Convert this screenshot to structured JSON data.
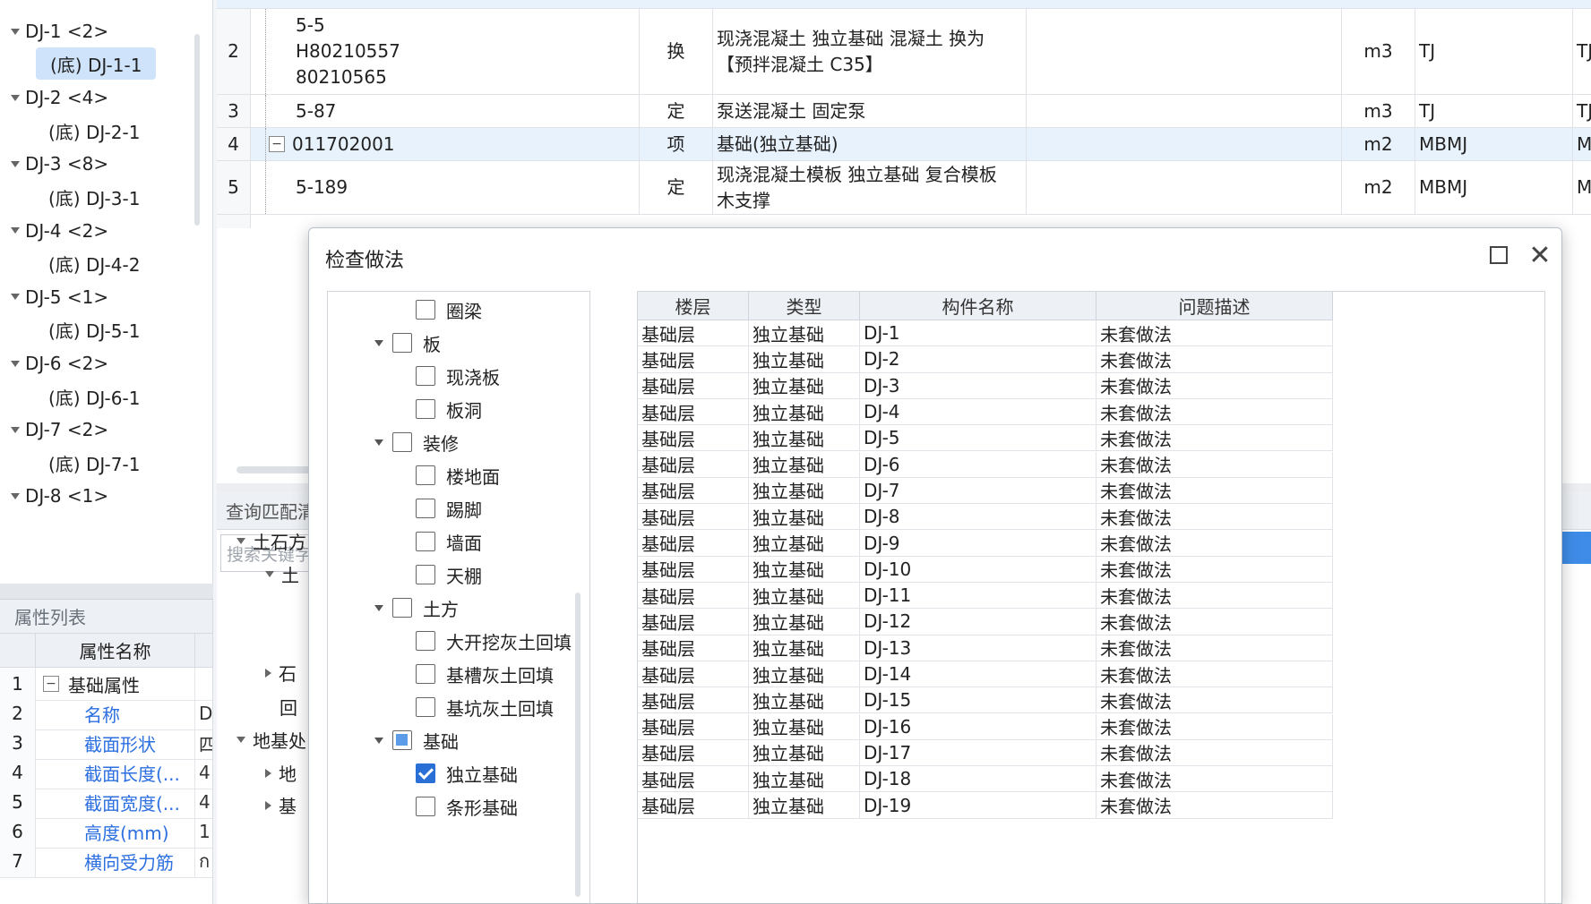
{
  "left_tree": {
    "items": [
      {
        "label": "DJ-1 <2>",
        "level": 0
      },
      {
        "label": "(底) DJ-1-1",
        "level": 1,
        "selected": true
      },
      {
        "label": "DJ-2 <4>",
        "level": 0
      },
      {
        "label": "(底) DJ-2-1",
        "level": 1
      },
      {
        "label": "DJ-3 <8>",
        "level": 0
      },
      {
        "label": "(底) DJ-3-1",
        "level": 1
      },
      {
        "label": "DJ-4 <2>",
        "level": 0
      },
      {
        "label": "(底) DJ-4-2",
        "level": 1
      },
      {
        "label": "DJ-5 <1>",
        "level": 0
      },
      {
        "label": "(底) DJ-5-1",
        "level": 1
      },
      {
        "label": "DJ-6 <2>",
        "level": 0
      },
      {
        "label": "(底) DJ-6-1",
        "level": 1
      },
      {
        "label": "DJ-7 <2>",
        "level": 0
      },
      {
        "label": "(底) DJ-7-1",
        "level": 1
      },
      {
        "label": "DJ-8 <1>",
        "level": 0
      }
    ]
  },
  "prop_panel": {
    "title": "属性列表",
    "header_name": "属性名称",
    "rows": [
      {
        "num": "1",
        "name": "基础属性",
        "group": true,
        "value": ""
      },
      {
        "num": "2",
        "name": "名称",
        "value": "D"
      },
      {
        "num": "3",
        "name": "截面形状",
        "value": "四"
      },
      {
        "num": "4",
        "name": "截面长度(...",
        "value": "4"
      },
      {
        "num": "5",
        "name": "截面宽度(...",
        "value": "4"
      },
      {
        "num": "6",
        "name": "高度(mm)",
        "value": "1"
      },
      {
        "num": "7",
        "name": "横向受力筋",
        "value": "ก"
      }
    ]
  },
  "top_table": {
    "rows": [
      {
        "num": "2",
        "code": "5-5\nH80210557\n80210565",
        "type": "换",
        "name": "现浇混凝土 独立基础 混凝土  换为\n【预拌混凝土 C35】",
        "unit": "m3",
        "expr": "TJ",
        "desc": "TJ<独基体积>"
      },
      {
        "num": "3",
        "code": "5-87",
        "type": "定",
        "name": "泵送混凝土 固定泵",
        "unit": "m3",
        "expr": "TJ",
        "desc": "TJ<独基体积>"
      },
      {
        "num": "4",
        "code": "011702001",
        "type": "项",
        "name": "基础(独立基础)",
        "unit": "m2",
        "expr": "MBMJ",
        "desc": "MBMJ<独基模板面积>",
        "group": true
      },
      {
        "num": "5",
        "code": "5-189",
        "type": "定",
        "name": "现浇混凝土模板 独立基础 复合模板\n木支撑",
        "unit": "m2",
        "expr": "MBMJ",
        "desc": "MBMJ<独基模板面积>"
      }
    ]
  },
  "mid_panel": {
    "title": "查询匹配清",
    "search_placeholder": "搜索关键字",
    "tree": [
      {
        "label": "土石方",
        "arrow": "down"
      },
      {
        "label": "土",
        "arrow": "down"
      },
      {
        "label": "石",
        "arrow": "right"
      },
      {
        "label": "回",
        "arrow": "none"
      },
      {
        "label": "地基处",
        "arrow": "down"
      },
      {
        "label": "地",
        "arrow": "right"
      },
      {
        "label": "基",
        "arrow": "right"
      }
    ]
  },
  "dialog": {
    "title": "检查做法",
    "tree": [
      {
        "label": "圈梁",
        "level": 1,
        "state": "none"
      },
      {
        "label": "板",
        "level": 0,
        "state": "none"
      },
      {
        "label": "现浇板",
        "level": 1,
        "state": "none"
      },
      {
        "label": "板洞",
        "level": 1,
        "state": "none"
      },
      {
        "label": "装修",
        "level": 0,
        "state": "none"
      },
      {
        "label": "楼地面",
        "level": 1,
        "state": "none"
      },
      {
        "label": "踢脚",
        "level": 1,
        "state": "none"
      },
      {
        "label": "墙面",
        "level": 1,
        "state": "none"
      },
      {
        "label": "天棚",
        "level": 1,
        "state": "none"
      },
      {
        "label": "土方",
        "level": 0,
        "state": "none"
      },
      {
        "label": "大开挖灰土回填",
        "level": 1,
        "state": "none"
      },
      {
        "label": "基槽灰土回填",
        "level": 1,
        "state": "none"
      },
      {
        "label": "基坑灰土回填",
        "level": 1,
        "state": "none"
      },
      {
        "label": "基础",
        "level": 0,
        "state": "partial"
      },
      {
        "label": "独立基础",
        "level": 1,
        "state": "checked"
      },
      {
        "label": "条形基础",
        "level": 1,
        "state": "none"
      }
    ],
    "grid": {
      "headers": [
        "楼层",
        "类型",
        "构件名称",
        "问题描述"
      ],
      "rows": [
        [
          "基础层",
          "独立基础",
          "DJ-1",
          "未套做法"
        ],
        [
          "基础层",
          "独立基础",
          "DJ-2",
          "未套做法"
        ],
        [
          "基础层",
          "独立基础",
          "DJ-3",
          "未套做法"
        ],
        [
          "基础层",
          "独立基础",
          "DJ-4",
          "未套做法"
        ],
        [
          "基础层",
          "独立基础",
          "DJ-5",
          "未套做法"
        ],
        [
          "基础层",
          "独立基础",
          "DJ-6",
          "未套做法"
        ],
        [
          "基础层",
          "独立基础",
          "DJ-7",
          "未套做法"
        ],
        [
          "基础层",
          "独立基础",
          "DJ-8",
          "未套做法"
        ],
        [
          "基础层",
          "独立基础",
          "DJ-9",
          "未套做法"
        ],
        [
          "基础层",
          "独立基础",
          "DJ-10",
          "未套做法"
        ],
        [
          "基础层",
          "独立基础",
          "DJ-11",
          "未套做法"
        ],
        [
          "基础层",
          "独立基础",
          "DJ-12",
          "未套做法"
        ],
        [
          "基础层",
          "独立基础",
          "DJ-13",
          "未套做法"
        ],
        [
          "基础层",
          "独立基础",
          "DJ-14",
          "未套做法"
        ],
        [
          "基础层",
          "独立基础",
          "DJ-15",
          "未套做法"
        ],
        [
          "基础层",
          "独立基础",
          "DJ-16",
          "未套做法"
        ],
        [
          "基础层",
          "独立基础",
          "DJ-17",
          "未套做法"
        ],
        [
          "基础层",
          "独立基础",
          "DJ-18",
          "未套做法"
        ],
        [
          "基础层",
          "独立基础",
          "DJ-19",
          "未套做法"
        ]
      ]
    }
  }
}
